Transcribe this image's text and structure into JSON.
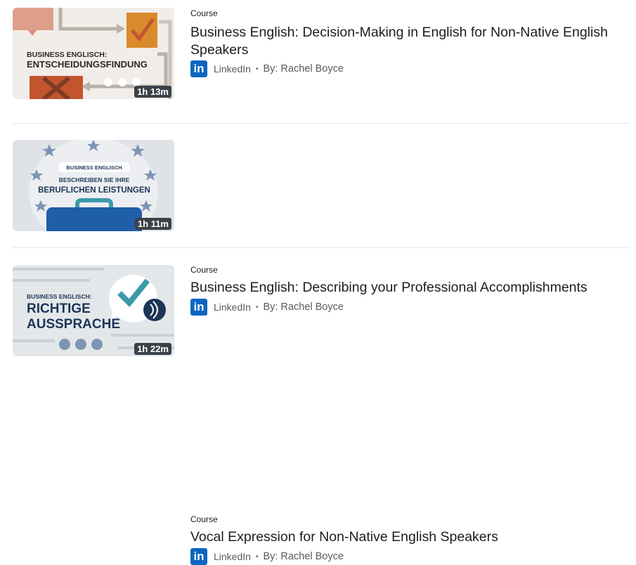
{
  "courses": [
    {
      "kind": "Course",
      "title": "Business English: Decision-Making in English for Non-Native English Speakers",
      "provider": "LinkedIn",
      "separator": "•",
      "author": "By: Rachel Boyce",
      "duration": "1h 13m",
      "thumb_line1": "BUSINESS ENGLISCH:",
      "thumb_line2": "ENTSCHEIDUNGSFINDUNG"
    },
    {
      "kind": "Course",
      "title": "Business English: Describing your Professional Accomplishments",
      "provider": "LinkedIn",
      "separator": "•",
      "author": "By: Rachel Boyce",
      "duration": "1h 11m",
      "thumb_line1": "BUSINESS ENGLISCH",
      "thumb_line2": "BESCHREIBEN SIE IHRE",
      "thumb_line3": "BERUFLICHEN LEISTUNGEN"
    },
    {
      "kind": "Course",
      "title": "Vocal Expression for Non-Native English Speakers",
      "provider": "LinkedIn",
      "separator": "•",
      "author": "By: Rachel Boyce",
      "duration": "1h 22m",
      "thumb_line1": "BUSINESS ENGLISCH:",
      "thumb_line2": "RICHTIGE",
      "thumb_line3": "AUSSPRACHE"
    }
  ],
  "logo_letters": "in",
  "colors": {
    "linkedin_blue": "#0a66c2",
    "thumb_orange": "#d98b2b",
    "thumb_red": "#c2552e",
    "thumb_navy": "#1d3557",
    "thumb_teal": "#3a9aa7"
  }
}
